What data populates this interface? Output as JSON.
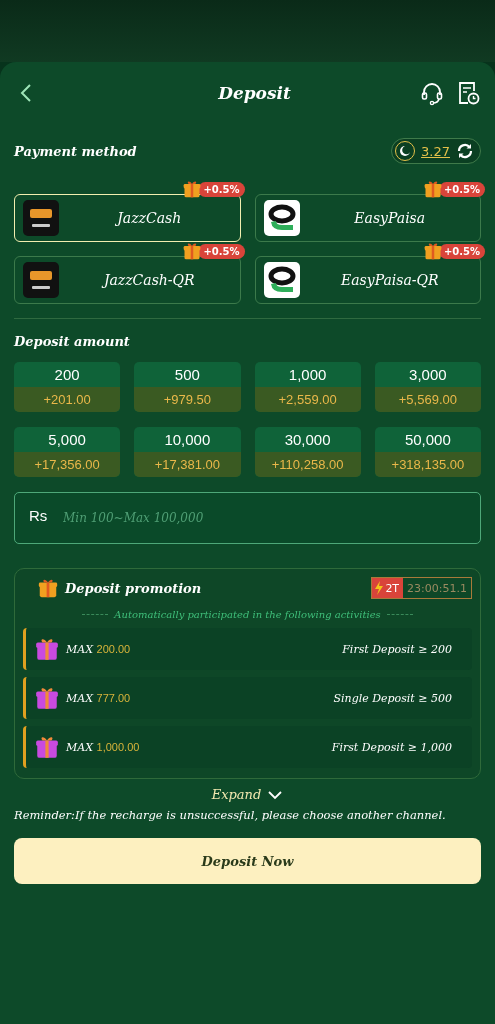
{
  "header": {
    "title": "Deposit"
  },
  "payment": {
    "label": "Payment method",
    "rate": "3.27",
    "methods": [
      {
        "name": "JazzCash",
        "kind": "jazzcash",
        "bonus": "+0.5%",
        "selected": true
      },
      {
        "name": "EasyPaisa",
        "kind": "easypaisa",
        "bonus": "+0.5%",
        "selected": false
      },
      {
        "name": "JazzCash-QR",
        "kind": "jazzcash",
        "bonus": "+0.5%",
        "selected": false
      },
      {
        "name": "EasyPaisa-QR",
        "kind": "easypaisa",
        "bonus": "+0.5%",
        "selected": false
      }
    ]
  },
  "amount": {
    "label": "Deposit amount",
    "options": [
      {
        "amount": "200",
        "bonus": "+201.00"
      },
      {
        "amount": "500",
        "bonus": "+979.50"
      },
      {
        "amount": "1,000",
        "bonus": "+2,559.00"
      },
      {
        "amount": "3,000",
        "bonus": "+5,569.00"
      },
      {
        "amount": "5,000",
        "bonus": "+17,356.00"
      },
      {
        "amount": "10,000",
        "bonus": "+17,381.00"
      },
      {
        "amount": "30,000",
        "bonus": "+110,258.00"
      },
      {
        "amount": "50,000",
        "bonus": "+318,135.00"
      }
    ],
    "input": {
      "currency": "Rs",
      "placeholder": "Min 100~Max 100,000"
    }
  },
  "promotion": {
    "title": "Deposit promotion",
    "badge": "2T",
    "timer": "23:00:51.1",
    "subtitle": "Automatically participated in the following activities",
    "items": [
      {
        "prefix": "MAX",
        "value": "200.00",
        "condition": "First Deposit ≥ 200"
      },
      {
        "prefix": "MAX",
        "value": "777.00",
        "condition": "Single Deposit ≥ 500"
      },
      {
        "prefix": "MAX",
        "value": "1,000.00",
        "condition": "First Deposit ≥ 1,000"
      }
    ]
  },
  "expand": "Expand",
  "reminder": "Reminder:If the recharge is unsuccessful, please choose another channel.",
  "button": "Deposit Now"
}
